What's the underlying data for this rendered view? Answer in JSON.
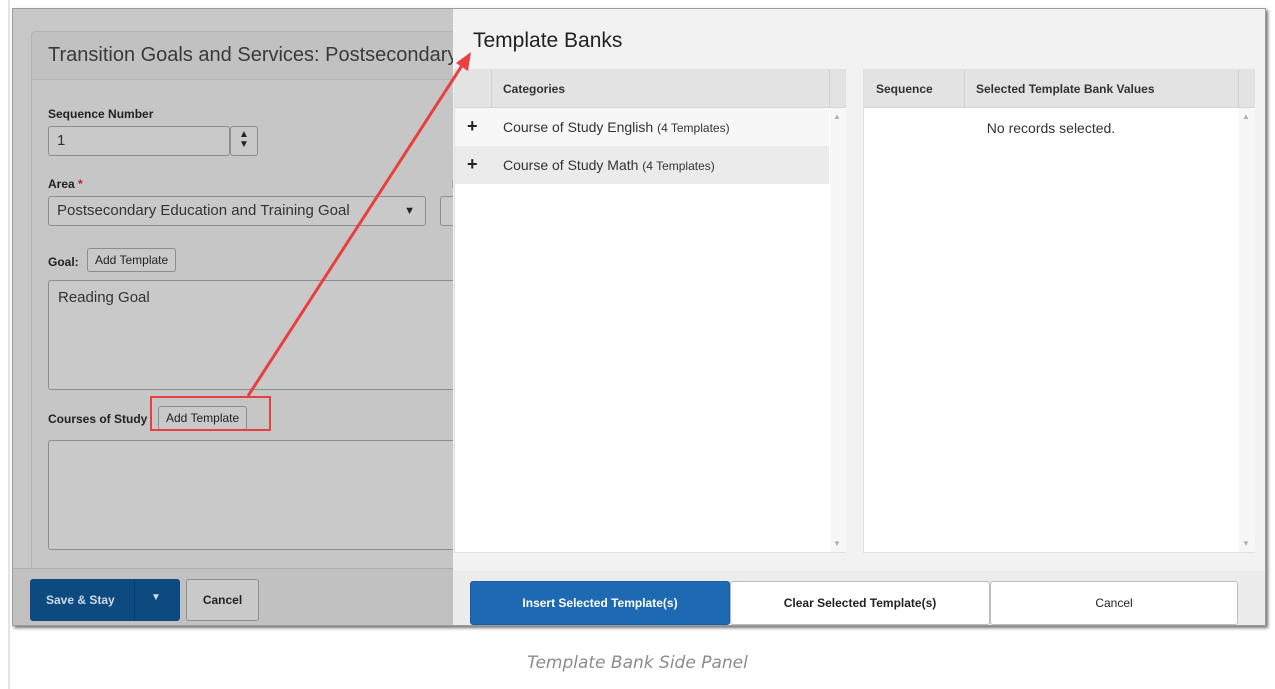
{
  "form": {
    "title": "Transition Goals and Services: Postsecondary",
    "sequence_label": "Sequence Number",
    "sequence_value": "1",
    "area_label": "Area",
    "area_required_mark": "*",
    "area_value": "Postsecondary Education and Training Goal",
    "clipped_label": "M",
    "goal_label": "Goal:",
    "goal_add_template": "Add Template",
    "goal_text": "Reading Goal",
    "courses_label": "Courses of Study",
    "courses_add_template": "Add Template",
    "courses_text": ""
  },
  "actions": {
    "save_stay": "Save & Stay",
    "cancel": "Cancel"
  },
  "panel": {
    "title": "Template Banks",
    "categories_header": "Categories",
    "categories": [
      {
        "name": "Course of Study English",
        "count": "(4 Templates)"
      },
      {
        "name": "Course of Study Math",
        "count": "(4 Templates)"
      }
    ],
    "sequence_header": "Sequence",
    "selected_header": "Selected Template Bank Values",
    "empty_message": "No records selected.",
    "insert_button": "Insert Selected Template(s)",
    "clear_button": "Clear Selected Template(s)",
    "cancel_button": "Cancel"
  },
  "caption": "Template Bank Side Panel",
  "colors": {
    "primary_blue": "#1e6ab2",
    "save_blue": "#0c4a80",
    "annotation_red": "#e8403f"
  }
}
